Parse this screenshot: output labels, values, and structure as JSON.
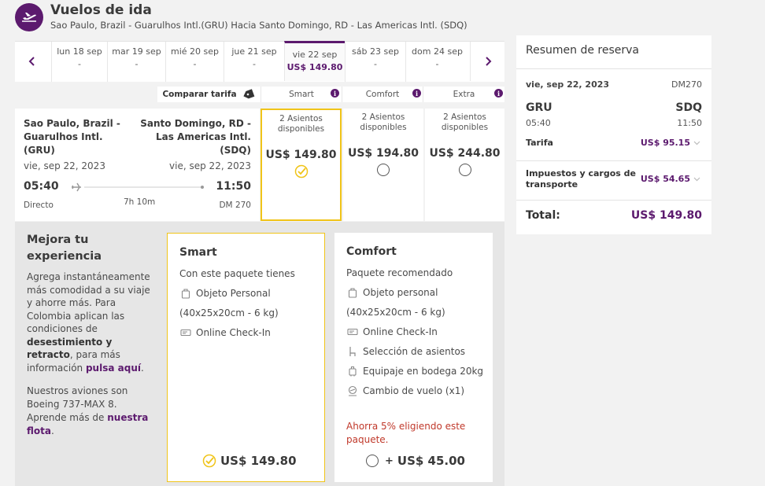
{
  "header": {
    "title": "Vuelos de ida",
    "subtitle": "Sao Paulo, Brazil - Guarulhos Intl.(GRU) Hacia Santo Domingo, RD - Las Americas Intl. (SDQ)"
  },
  "dates": [
    {
      "label": "lun 18 sep",
      "price": "-"
    },
    {
      "label": "mar 19 sep",
      "price": "-"
    },
    {
      "label": "mié 20 sep",
      "price": "-"
    },
    {
      "label": "jue 21 sep",
      "price": "-"
    },
    {
      "label": "vie 22 sep",
      "price": "US$ 149.80"
    },
    {
      "label": "sáb 23 sep",
      "price": "-"
    },
    {
      "label": "dom 24 sep",
      "price": "-"
    }
  ],
  "compare": {
    "label": "Comparar tarifa",
    "smart": "Smart",
    "comfort": "Comfort",
    "extra": "Extra",
    "info": "i"
  },
  "flight": {
    "origin_city": "Sao Paulo, Brazil -",
    "origin_airport": "Guarulhos Intl.",
    "origin_code": "(GRU)",
    "dest_city": "Santo Domingo, RD -",
    "dest_airport": "Las Americas Intl.",
    "dest_code": "(SDQ)",
    "dep_date": "vie, sep 22, 2023",
    "arr_date": "vie, sep 22, 2023",
    "dep_time": "05:40",
    "arr_time": "11:50",
    "type": "Directo",
    "duration": "7h 10m",
    "number": "DM 270"
  },
  "fares": [
    {
      "seats_line1": "2 Asientos",
      "seats_line2": "disponibles",
      "price": "US$ 149.80",
      "selected": true
    },
    {
      "seats_line1": "2 Asientos",
      "seats_line2": "disponibles",
      "price": "US$ 194.80",
      "selected": false
    },
    {
      "seats_line1": "2 Asientos",
      "seats_line2": "disponibles",
      "price": "US$ 244.80",
      "selected": false
    }
  ],
  "improve": {
    "title_line1": "Mejora tu",
    "title_line2": "experiencia",
    "p1_lines": [
      "Agrega instantáneamente",
      "más comodidad a su viaje",
      "y ahorre más. Para",
      "Colombia aplican las",
      "condiciones de"
    ],
    "p1_bold1": "desestimiento y",
    "p1_bold2": "retracto",
    "p1_after_bold": ", para más",
    "p1_pre_link": "información ",
    "p1_link": "pulsa aquí",
    "p1_end": ".",
    "p2_line1": "Nuestros aviones son",
    "p2_line2": "Boeing 737-MAX 8.",
    "p2_pre_link": "Aprende más de ",
    "p2_link1": "nuestra",
    "p2_link2": "flota",
    "p2_end": "."
  },
  "smart_pkg": {
    "title": "Smart",
    "intro": "Con este paquete tienes",
    "items": [
      "Objeto Personal",
      "(40x25x20cm - 6 kg)",
      "Online Check-In"
    ],
    "price": "US$ 149.80"
  },
  "comfort_pkg": {
    "title": "Comfort",
    "intro": "Paquete recomendado",
    "items": [
      "Objeto personal",
      "(40x25x20cm - 6 kg)",
      "Online Check-In",
      "Selección de asientos",
      "Equipaje en bodega 20kg",
      "Cambio de vuelo (x1)"
    ],
    "promo_line1": "Ahorra 5% eligiendo este",
    "promo_line2": "paquete.",
    "plus": "+",
    "price": "US$ 45.00"
  },
  "summary": {
    "title": "Resumen de reserva",
    "date": "vie, sep 22, 2023",
    "flight_no": "DM270",
    "origin": "GRU",
    "dest": "SDQ",
    "dep": "05:40",
    "arr": "11:50",
    "fare_label": "Tarifa",
    "fare_value": "US$ 95.15",
    "tax_label_line1": "Impuestos y cargos de",
    "tax_label_line2": "transporte",
    "tax_value": "US$ 54.65",
    "total_label": "Total:",
    "total_value": "US$ 149.80"
  },
  "colors": {
    "brand": "#5c1a6e",
    "highlight": "#f0c419",
    "promo": "#c0392b"
  }
}
